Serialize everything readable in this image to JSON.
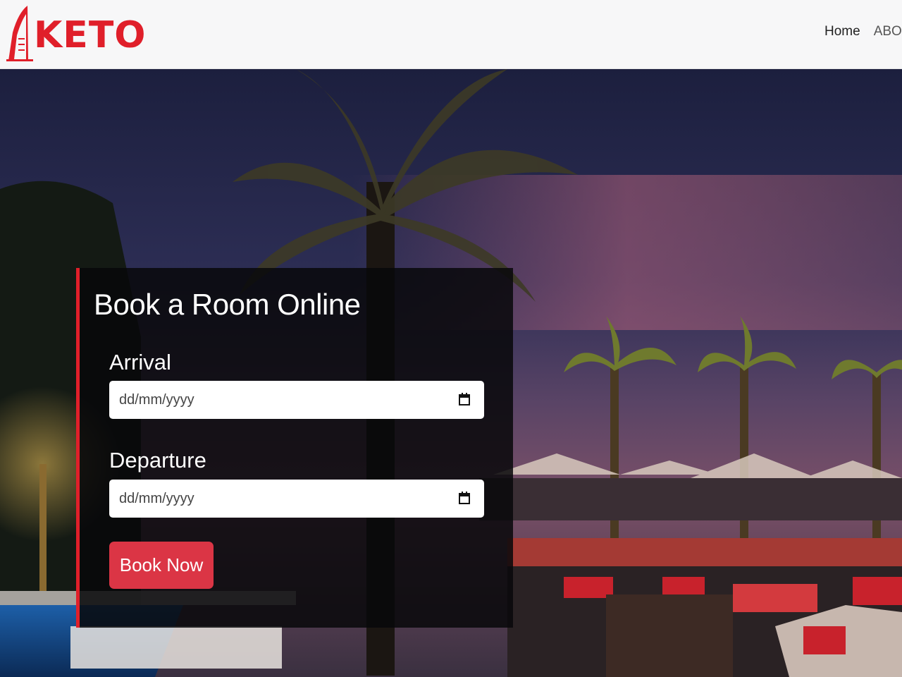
{
  "brand": {
    "name": "KETO",
    "color": "#e01f2a",
    "icon": "tower-icon"
  },
  "nav": {
    "items": [
      "Home",
      "ABOU"
    ]
  },
  "booking": {
    "title": "Book a Room Online",
    "arrival": {
      "label": "Arrival",
      "placeholder": "dd/mm/yyyy",
      "icon": "calendar-icon"
    },
    "departure": {
      "label": "Departure",
      "placeholder": "dd/mm/yyyy",
      "icon": "calendar-icon"
    },
    "button": "Book Now",
    "accent": "#db3545"
  }
}
